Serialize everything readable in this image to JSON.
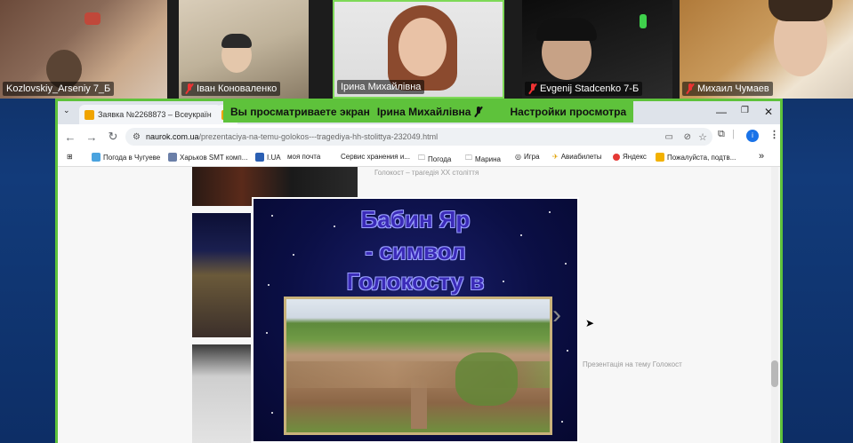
{
  "participants": [
    {
      "name": "Kozlovskiy_Arseniy 7_Б",
      "muted": false
    },
    {
      "name": "Іван Коноваленко",
      "muted": true
    },
    {
      "name": "Ірина Михайлівна",
      "muted": false
    },
    {
      "name": "Evgenij Stadcenko 7-Б",
      "muted": true
    },
    {
      "name": "Михаил Чумаев",
      "muted": true
    }
  ],
  "share_banner": {
    "text": "Вы просматриваете экран",
    "presenter": "Ірина Михайлівна",
    "settings": "Настройки просмотра"
  },
  "browser": {
    "tabs": [
      {
        "label": "Заявка №2268873 – Всеукраїн"
      },
      {
        "label": ""
      }
    ],
    "url_domain": "naurok.com.ua",
    "url_path": "/prezentaciya-na-temu-golokos---tragediya-hh-stolittya-232049.html",
    "profile_letter": "і",
    "bookmarks": [
      {
        "label": "Погода в Чугуеве",
        "color": "#4aa3df"
      },
      {
        "label": "Харьков SMT комп...",
        "color": "#6b7fa8"
      },
      {
        "label": "I.UA",
        "color": "#2b5fb3"
      },
      {
        "label": "моя почта",
        "color": "#ffffff"
      },
      {
        "label": "Сервис хранения и...",
        "color": "#ffffff"
      },
      {
        "label": "Погода",
        "color": "#ffffff"
      },
      {
        "label": "Марина",
        "color": "#ffffff"
      },
      {
        "label": "Игра",
        "color": "#ffffff"
      },
      {
        "label": "Авиабилеты",
        "color": "#e0a000"
      },
      {
        "label": "Яндекс",
        "color": "#e53935"
      },
      {
        "label": "Пожалуйста, подтв...",
        "color": "#f2b100"
      }
    ],
    "bookmarks_more": "»",
    "faded_header": "Голокост – трагедія ХХ століття",
    "faded_line": "Презентація на тему Голокост"
  },
  "slide": {
    "title_lines": [
      "Бабин Яр",
      "- символ",
      "Голокосту в"
    ]
  },
  "icons": {
    "back": "arrow-left-icon",
    "forward": "arrow-right-icon",
    "reload": "reload-icon",
    "next_slide": "chevron-right-icon"
  }
}
